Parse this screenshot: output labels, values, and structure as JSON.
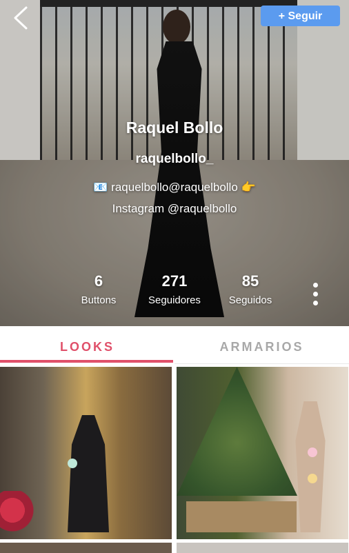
{
  "header": {
    "follow_label": "+ Seguir"
  },
  "profile": {
    "name": "Raquel Bollo",
    "handle": "raquelbollo_",
    "bio_line1": "📧 raquelbollo@raquelbollo 👉",
    "bio_line2": "Instagram @raquelbollo"
  },
  "stats": [
    {
      "value": "6",
      "label": "Buttons"
    },
    {
      "value": "271",
      "label": "Seguidores"
    },
    {
      "value": "85",
      "label": "Seguidos"
    }
  ],
  "tabs": [
    {
      "label": "LOOKS",
      "active": true
    },
    {
      "label": "ARMARIOS",
      "active": false
    }
  ],
  "colors": {
    "accent": "#e0506a",
    "follow_button": "#5b9bef",
    "inactive_tab": "#a8a8a8"
  },
  "icons": {
    "back": "chevron-left-icon",
    "more": "more-vertical-icon"
  }
}
